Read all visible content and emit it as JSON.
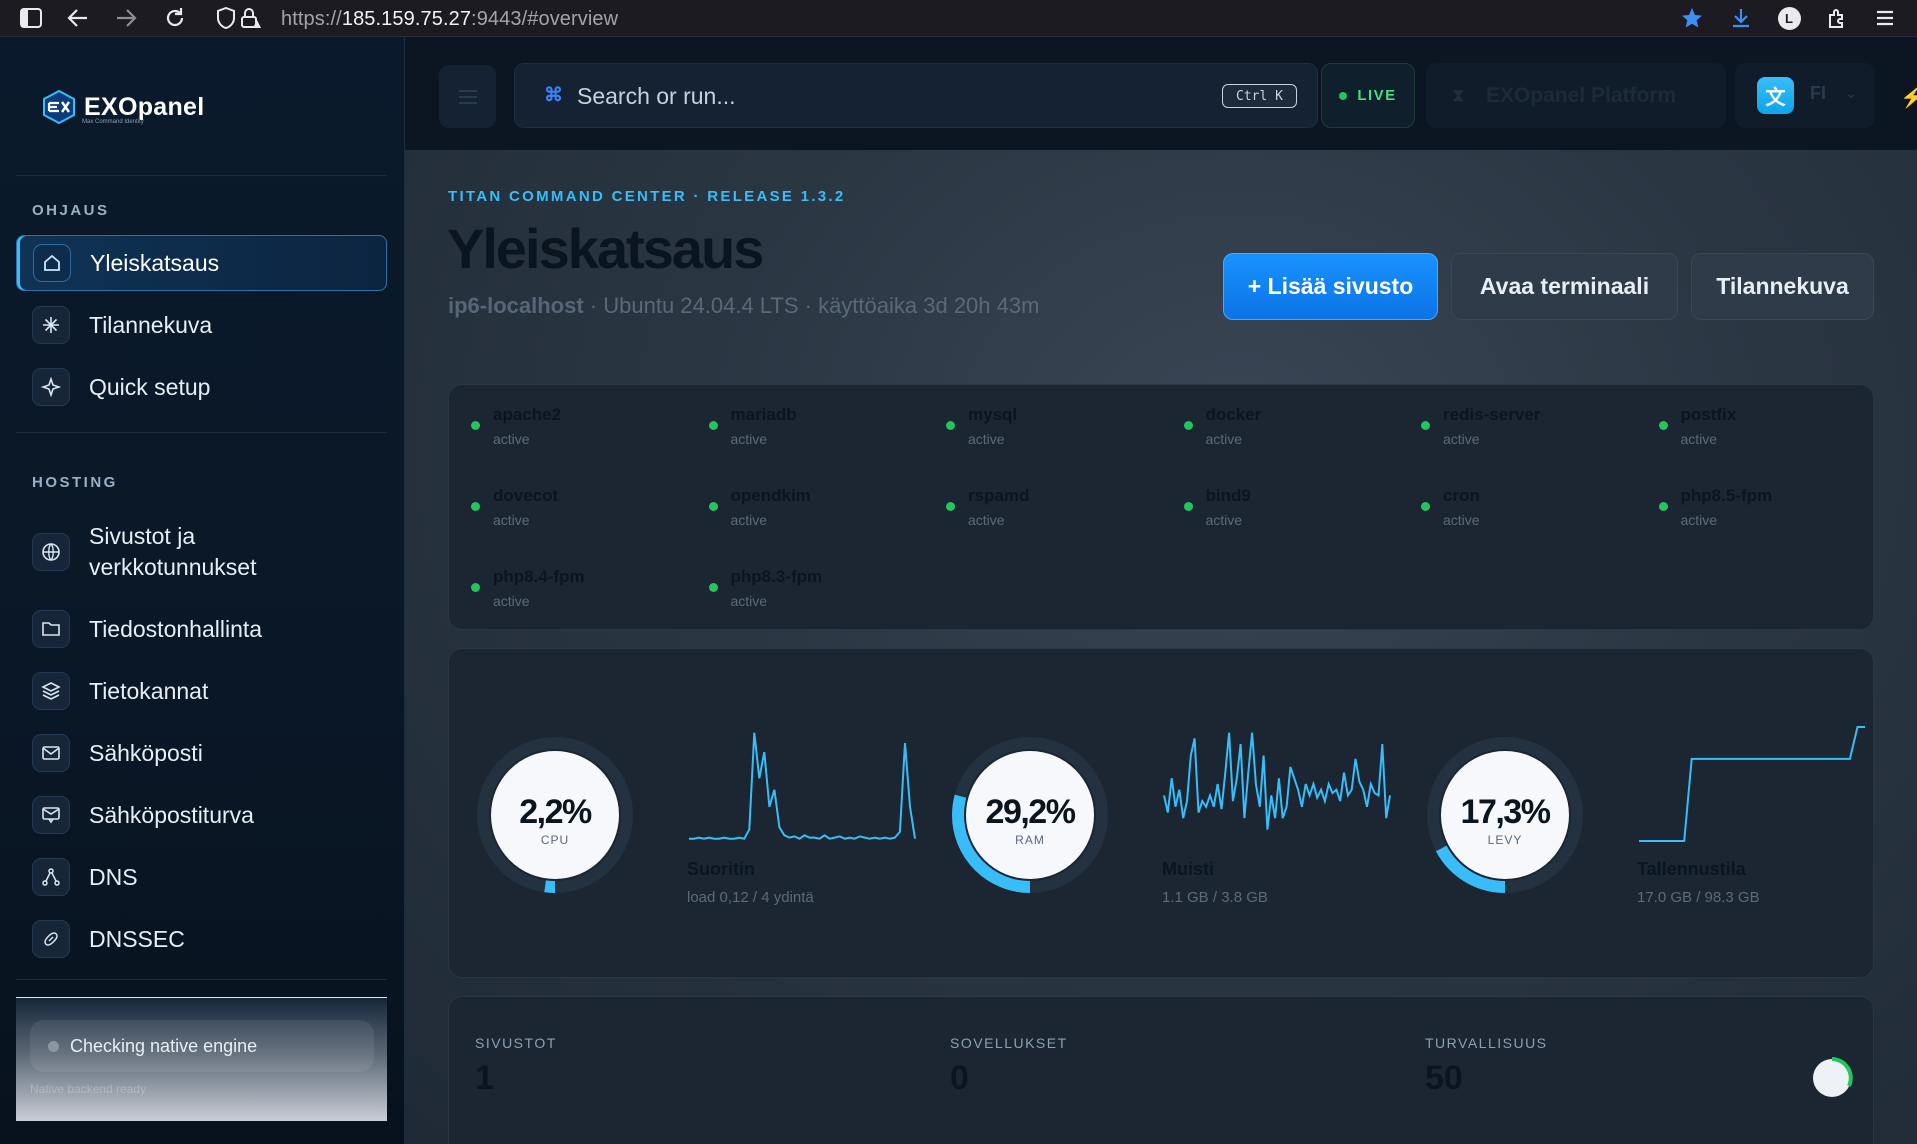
{
  "browser": {
    "url_prefix": "https://",
    "url_host": "185.159.75.27",
    "url_rest": ":9443/#overview",
    "profile_initial": "L"
  },
  "sidebar": {
    "logo": "EXOpanel",
    "logo_tagline": "Max Command Identity",
    "section_control": "OHJAUS",
    "section_hosting": "HOSTING",
    "control_items": [
      {
        "label": "Yleiskatsaus",
        "icon": "home-icon"
      },
      {
        "label": "Tilannekuva",
        "icon": "sparkle-icon"
      },
      {
        "label": "Quick setup",
        "icon": "star-icon"
      }
    ],
    "hosting_items": [
      {
        "label": "Sivustot ja verkkotunnukset",
        "icon": "globe-icon"
      },
      {
        "label": "Tiedostonhallinta",
        "icon": "folder-icon"
      },
      {
        "label": "Tietokannat",
        "icon": "layers-icon"
      },
      {
        "label": "Sähköposti",
        "icon": "mail-icon"
      },
      {
        "label": "Sähköpostiturva",
        "icon": "mail-shield-icon"
      },
      {
        "label": "DNS",
        "icon": "network-icon"
      },
      {
        "label": "DNSSEC",
        "icon": "key-icon"
      }
    ],
    "engine_status": "Checking native engine",
    "engine_sub": "Native backend ready"
  },
  "topbar": {
    "search_placeholder": "Search or run...",
    "search_shortcut": "Ctrl K",
    "live_label": "LIVE",
    "platform_label": "EXOpanel Platform",
    "lang_code": "FI"
  },
  "header": {
    "eyebrow": "TITAN COMMAND CENTER · RELEASE 1.3.2",
    "title": "Yleiskatsaus",
    "hostname": "ip6-localhost",
    "details": " · Ubuntu 24.04.4 LTS · käyttöaika 3d 20h 43m",
    "btn_add": "+ Lisää sivusto",
    "btn_terminal": "Avaa terminaali",
    "btn_snapshot": "Tilannekuva"
  },
  "services": [
    {
      "name": "apache2",
      "status": "active"
    },
    {
      "name": "mariadb",
      "status": "active"
    },
    {
      "name": "mysql",
      "status": "active"
    },
    {
      "name": "docker",
      "status": "active"
    },
    {
      "name": "redis-server",
      "status": "active"
    },
    {
      "name": "postfix",
      "status": "active"
    },
    {
      "name": "dovecot",
      "status": "active"
    },
    {
      "name": "opendkim",
      "status": "active"
    },
    {
      "name": "rspamd",
      "status": "active"
    },
    {
      "name": "bind9",
      "status": "active"
    },
    {
      "name": "cron",
      "status": "active"
    },
    {
      "name": "php8.5-fpm",
      "status": "active"
    },
    {
      "name": "php8.4-fpm",
      "status": "active"
    },
    {
      "name": "php8.3-fpm",
      "status": "active"
    }
  ],
  "metrics": [
    {
      "value": "2,2%",
      "caption": "CPU",
      "fraction": 0.022,
      "label": "Suoritin",
      "sub": "load 0,12 / 4 ydintä",
      "spark": [
        0.02,
        0.02,
        0.03,
        0.02,
        0.03,
        0.02,
        0.02,
        0.03,
        0.02,
        0.02,
        0.03,
        0.02,
        0.1,
        0.95,
        0.55,
        0.78,
        0.3,
        0.45,
        0.12,
        0.05,
        0.03,
        0.04,
        0.02,
        0.05,
        0.03,
        0.03,
        0.02,
        0.05,
        0.02,
        0.03,
        0.04,
        0.02,
        0.03,
        0.02,
        0.04,
        0.03,
        0.02,
        0.03,
        0.02,
        0.03,
        0.02,
        0.03,
        0.08,
        0.86,
        0.3,
        0.02
      ]
    },
    {
      "value": "29,2%",
      "caption": "RAM",
      "fraction": 0.292,
      "label": "Muisti",
      "sub": "1.1 GB / 3.8 GB",
      "spark": [
        0.4,
        0.25,
        0.55,
        0.3,
        0.45,
        0.2,
        0.35,
        0.75,
        0.9,
        0.25,
        0.35,
        0.3,
        0.4,
        0.3,
        0.5,
        0.28,
        0.6,
        0.95,
        0.35,
        0.55,
        0.85,
        0.2,
        0.6,
        0.95,
        0.5,
        0.3,
        0.75,
        0.1,
        0.4,
        0.2,
        0.55,
        0.2,
        0.3,
        0.65,
        0.55,
        0.45,
        0.3,
        0.5,
        0.4,
        0.5,
        0.38,
        0.45,
        0.35,
        0.5,
        0.42,
        0.45,
        0.35,
        0.6,
        0.4,
        0.45,
        0.72,
        0.52,
        0.45,
        0.3,
        0.5,
        0.42,
        0.4,
        0.85,
        0.2,
        0.4
      ]
    },
    {
      "value": "17,3%",
      "caption": "LEVY",
      "fraction": 0.173,
      "label": "Tallennustila",
      "sub": "17.0 GB / 98.3 GB",
      "spark": [
        0.0,
        0.0,
        0.0,
        0.0,
        0.0,
        0.0,
        0.0,
        0.72,
        0.72,
        0.72,
        0.72,
        0.72,
        0.72,
        0.72,
        0.72,
        0.72,
        0.72,
        0.72,
        0.72,
        0.72,
        0.72,
        0.72,
        0.72,
        0.72,
        0.72,
        0.72,
        0.72,
        0.72,
        0.72,
        1.0,
        1.0
      ]
    }
  ],
  "stats": [
    {
      "label": "SIVUSTOT",
      "value": "1"
    },
    {
      "label": "SOVELLUKSET",
      "value": "0"
    },
    {
      "label": "TURVALLISUUS",
      "value": "50"
    }
  ],
  "colors": {
    "accent": "#38bdf8",
    "primary": "#0b72e6",
    "ok": "#22c55e"
  }
}
